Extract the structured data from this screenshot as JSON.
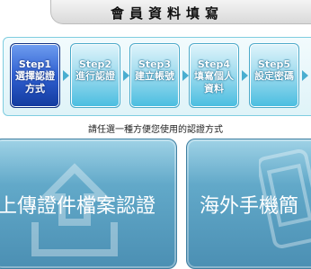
{
  "header": {
    "title": "會員資料填寫"
  },
  "steps": [
    {
      "label": "Step1",
      "desc": "選擇認證方式",
      "active": true
    },
    {
      "label": "Step2",
      "desc": "進行認證",
      "active": false
    },
    {
      "label": "Step3",
      "desc": "建立帳號",
      "active": false
    },
    {
      "label": "Step4",
      "desc": "填寫個人資料",
      "active": false
    },
    {
      "label": "Step5",
      "desc": "設定密碼",
      "active": false
    }
  ],
  "instruction": "請任選一種方便您使用的認證方式",
  "options": {
    "upload": {
      "label": "上傳證件檔案認證",
      "icon": "upload-icon"
    },
    "overseas_phone": {
      "label": "海外手機簡",
      "icon": "phone-icon"
    }
  },
  "colors": {
    "active_step": "#1f4fbf",
    "step": "#4bbde0",
    "card": "#5b9fc2"
  }
}
